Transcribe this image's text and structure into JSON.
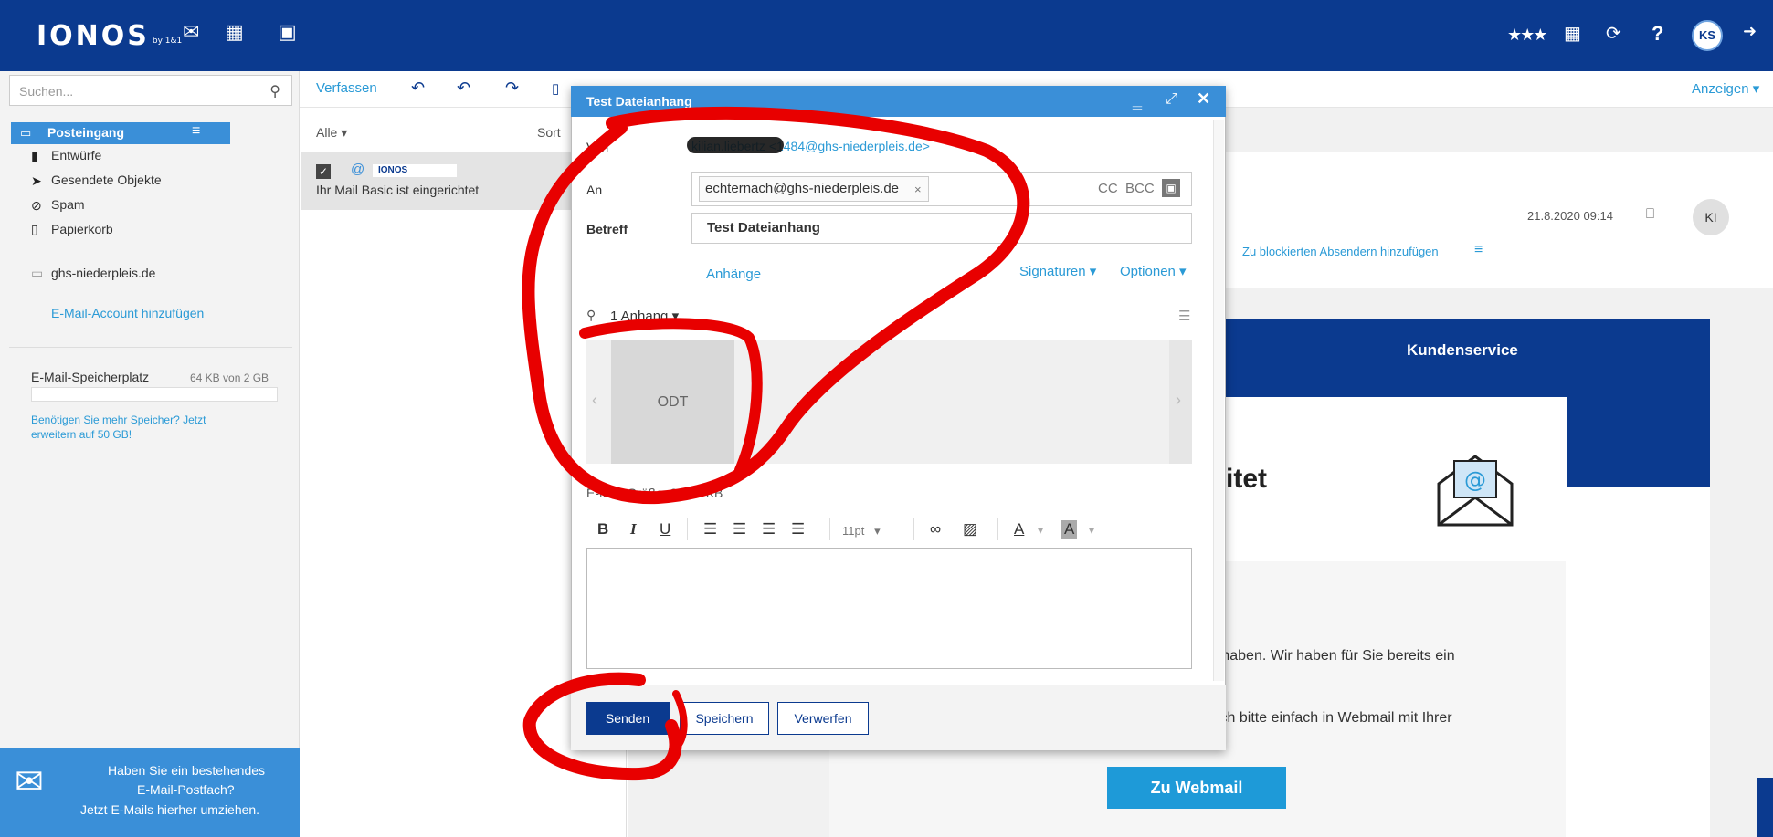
{
  "header": {
    "logo": "IONOS",
    "logo_sub": "by 1&1",
    "avatar": "KS",
    "icons": [
      "mail-icon",
      "calendar-icon",
      "contacts-icon",
      "rating-icon",
      "apps-icon",
      "refresh-icon",
      "help-icon",
      "logout-icon"
    ]
  },
  "sidebar": {
    "search_placeholder": "Suchen...",
    "folders": {
      "inbox": "Posteingang",
      "drafts": "Entwürfe",
      "sent": "Gesendete Objekte",
      "spam": "Spam",
      "trash": "Papierkorb",
      "domain": "ghs-niederpleis.de"
    },
    "add_account": "E-Mail-Account hinzufügen",
    "storage_label": "E-Mail-Speicherplatz",
    "storage_value": "64 KB von 2 GB",
    "upgrade_text_1": "Benötigen Sie mehr Speicher? Jetzt",
    "upgrade_text_2": "erweitern auf 50 GB!",
    "promo_1": "Haben Sie ein bestehendes",
    "promo_2": "E-Mail-Postfach?",
    "promo_3": "Jetzt E-Mails hierher umziehen."
  },
  "toolbar": {
    "compose": "Verfassen",
    "show": "Anzeigen"
  },
  "list": {
    "filter": "Alle",
    "sort": "Sort",
    "item_sender": "IONOS",
    "item_subject": "Ihr Mail Basic ist eingerichtet"
  },
  "reading": {
    "date": "21.8.2020 09:14",
    "avatar": "KI",
    "block_link": "Zu blockierten Absendern hinzufügen",
    "banner_title": "Kundenservice",
    "heading_tail": "itet",
    "para1": "n haben. Wir haben für Sie bereits ein",
    "para2": "sich bitte einfach in Webmail mit Ihrer",
    "webmail_button": "Zu Webmail"
  },
  "dialog": {
    "title": "Test Dateianhang",
    "from_label": "Von",
    "from_value": "kilian.liebertz <1484@ghs-niederpleis.de>",
    "to_label": "An",
    "to_chip": "echternach@ghs-niederpleis.de",
    "cc": "CC",
    "bcc": "BCC",
    "subject_label": "Betreff",
    "subject_value": "Test Dateianhang",
    "attachments_link": "Anhänge",
    "signatures": "Signaturen",
    "options": "Optionen",
    "attachment_count": "1 Anhang",
    "attachment_type": "ODT",
    "size_label": "E-Mail-Größe: 96.50 KB",
    "font_size": "11pt",
    "send": "Senden",
    "save": "Speichern",
    "discard": "Verwerfen"
  },
  "annotation_color": "#e80000"
}
